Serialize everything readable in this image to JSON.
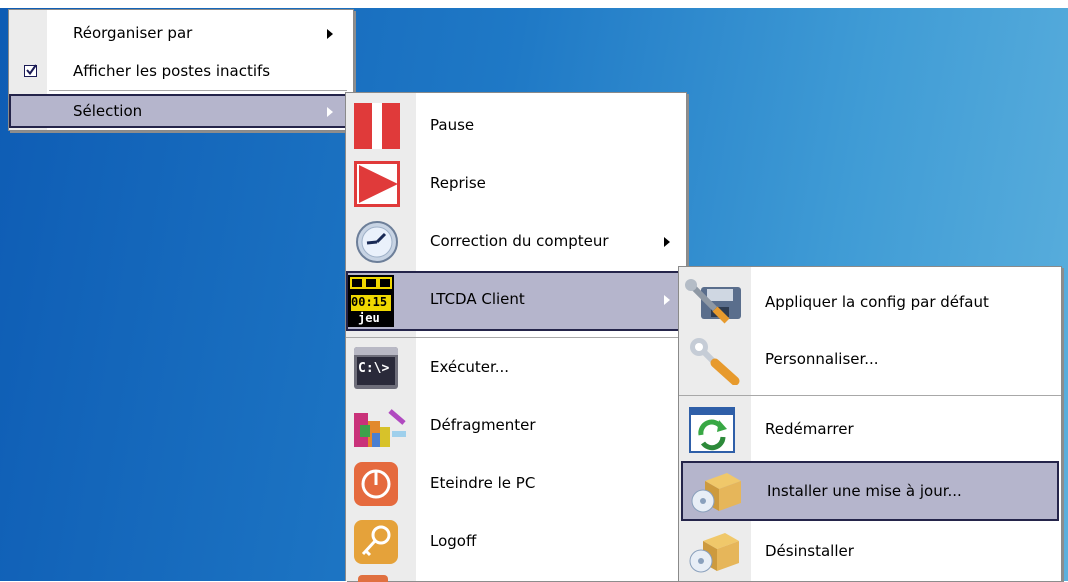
{
  "menu_main": {
    "items": [
      {
        "label": "Réorganiser par",
        "submenu": true
      },
      {
        "label": "Afficher les postes inactifs",
        "checked": true
      },
      {
        "label": "Sélection",
        "submenu": true,
        "selected": true
      }
    ]
  },
  "menu_selection": {
    "items": [
      {
        "label": "Pause",
        "icon": "pause-icon"
      },
      {
        "label": "Reprise",
        "icon": "play-icon"
      },
      {
        "label": "Correction du compteur",
        "icon": "clock-icon",
        "submenu": true
      },
      {
        "label": "LTCDA Client",
        "icon": "ltcda-logo-icon",
        "submenu": true,
        "selected": true,
        "icon_text": [
          "00:15",
          "jeu"
        ]
      },
      {
        "label": "Exécuter...",
        "icon": "command-prompt-icon",
        "icon_text": "C:\\>"
      },
      {
        "label": "Défragmenter",
        "icon": "defrag-icon"
      },
      {
        "label": "Eteindre le PC",
        "icon": "power-icon"
      },
      {
        "label": "Logoff",
        "icon": "key-icon"
      }
    ]
  },
  "menu_ltcda": {
    "items": [
      {
        "label": "Appliquer la config par défaut",
        "icon": "config-icon"
      },
      {
        "label": "Personnaliser...",
        "icon": "wrench-icon"
      },
      {
        "label": "Redémarrer",
        "icon": "restart-icon"
      },
      {
        "label": "Installer une mise à jour...",
        "icon": "install-icon",
        "selected": true
      },
      {
        "label": "Désinstaller",
        "icon": "uninstall-icon"
      }
    ]
  },
  "colors": {
    "desktop": "#1f79c6",
    "menu_bg": "#ffffff",
    "gutter": "#ececec",
    "selected_bg": "#b5b5cc",
    "selected_border": "#24244a",
    "pause_red": "#e03a3a",
    "logo_yellow": "#f0d800"
  }
}
